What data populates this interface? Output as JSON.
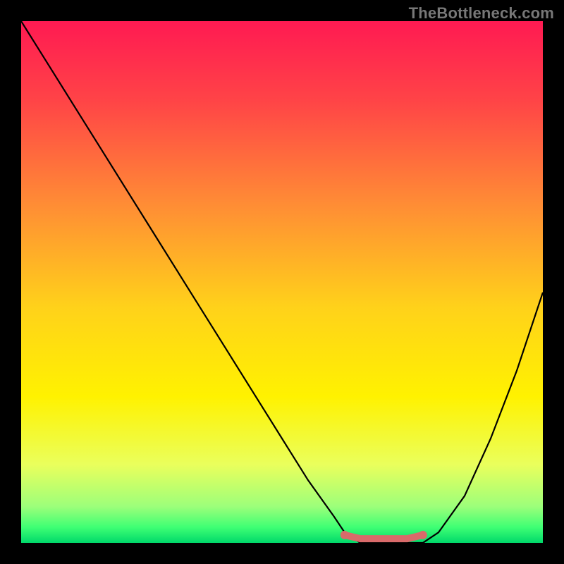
{
  "watermark": "TheBottleneck.com",
  "chart_data": {
    "type": "line",
    "title": "",
    "xlabel": "",
    "ylabel": "",
    "xlim": [
      0,
      100
    ],
    "ylim": [
      0,
      100
    ],
    "x": [
      0,
      5,
      10,
      15,
      20,
      25,
      30,
      35,
      40,
      45,
      50,
      55,
      60,
      62,
      65,
      68,
      71,
      74,
      77,
      80,
      85,
      90,
      95,
      100
    ],
    "values": [
      100,
      92,
      84,
      76,
      68,
      60,
      52,
      44,
      36,
      28,
      20,
      12,
      5,
      2,
      0,
      0,
      0,
      0,
      0,
      2,
      9,
      20,
      33,
      48
    ],
    "markers": {
      "x": [
        62,
        65,
        68,
        71,
        74,
        77
      ],
      "y": [
        1.5,
        0.8,
        0.8,
        0.8,
        0.8,
        1.5
      ]
    },
    "gradient_stops": [
      {
        "offset": 0.0,
        "color": "#ff1a52"
      },
      {
        "offset": 0.15,
        "color": "#ff4347"
      },
      {
        "offset": 0.35,
        "color": "#ff8c35"
      },
      {
        "offset": 0.55,
        "color": "#ffd21a"
      },
      {
        "offset": 0.72,
        "color": "#fff200"
      },
      {
        "offset": 0.85,
        "color": "#eaff5c"
      },
      {
        "offset": 0.93,
        "color": "#9dff7a"
      },
      {
        "offset": 0.97,
        "color": "#3fff74"
      },
      {
        "offset": 1.0,
        "color": "#00d96a"
      }
    ],
    "marker_color": "#d96a6a",
    "line_color": "#000000"
  }
}
